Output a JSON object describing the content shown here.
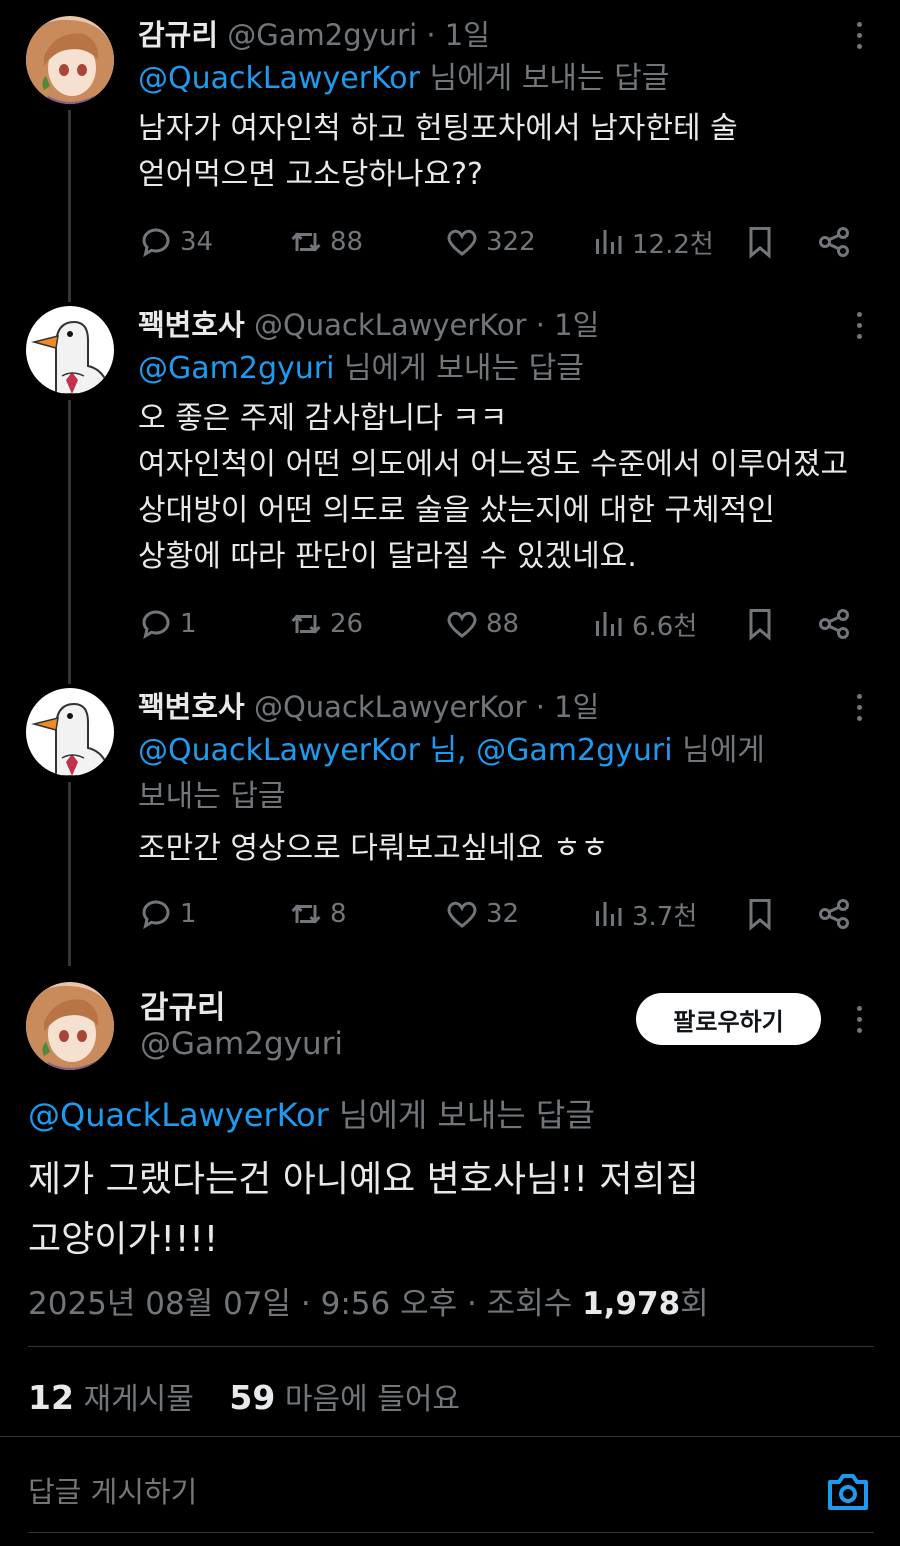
{
  "replies": [
    {
      "name": "감규리",
      "handle": "@Gam2gyuri",
      "time": "· 1일",
      "reply_prefix_mentions": "@QuackLawyerKor",
      "reply_suffix": " 님에게 보내는 답글",
      "lines": [
        "남자가 여자인척 하고 헌팅포차에서 남자한테 술",
        "얻어먹으면 고소당하나요??"
      ],
      "stats": {
        "replies": "34",
        "retweets": "88",
        "likes": "322",
        "views": "12.2천"
      }
    },
    {
      "name": "꽥변호사",
      "handle": "@QuackLawyerKor",
      "time": "· 1일",
      "reply_prefix_mentions": "@Gam2gyuri",
      "reply_suffix": " 님에게 보내는 답글",
      "lines": [
        "오 좋은 주제 감사합니다 ㅋㅋ",
        "여자인척이 어떤 의도에서 어느정도 수준에서 이루어졌고",
        "상대방이 어떤 의도로 술을 샀는지에 대한 구체적인",
        "상황에 따라 판단이 달라질 수 있겠네요."
      ],
      "stats": {
        "replies": "1",
        "retweets": "26",
        "likes": "88",
        "views": "6.6천"
      }
    },
    {
      "name": "꽥변호사",
      "handle": "@QuackLawyerKor",
      "time": "· 1일",
      "reply_prefix_mentions": "@QuackLawyerKor 님, @Gam2gyuri",
      "reply_suffix": " 님에게",
      "reply_second_line": "보내는 답글",
      "lines": [
        "조만간 영상으로 다뤄보고싶네요 ㅎㅎ"
      ],
      "stats": {
        "replies": "1",
        "retweets": "8",
        "likes": "32",
        "views": "3.7천"
      }
    }
  ],
  "main": {
    "name": "감규리",
    "handle": "@Gam2gyuri",
    "follow_label": "팔로우하기",
    "reply_mention": "@QuackLawyerKor",
    "reply_suffix": " 님에게 보내는 답글",
    "lines": [
      "제가 그랬다는건 아니예요 변호사님!! 저희집",
      "고양이가!!!!"
    ],
    "date": "2025년 08월 07일 · 9:56 오후 · 조회수 ",
    "views": "1,978",
    "views_unit": "회",
    "retweet_count": "12",
    "retweet_label": " 재게시물",
    "like_count": "59",
    "like_label": " 마음에 들어요"
  },
  "composer": {
    "placeholder": "답글 게시하기"
  },
  "colors": {
    "accent": "#1d9bf0",
    "muted": "#71767b",
    "text": "#e7e9ea",
    "background": "#000000"
  },
  "icons": [
    "reply-icon",
    "retweet-icon",
    "like-icon",
    "views-icon",
    "bookmark-icon",
    "share-icon",
    "more-icon",
    "camera-icon"
  ]
}
